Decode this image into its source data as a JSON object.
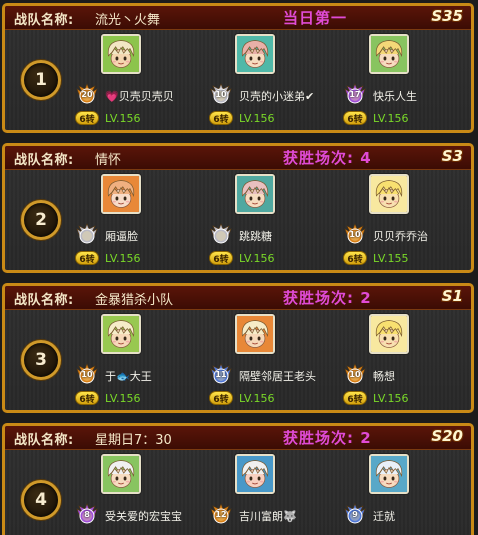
{
  "teams": [
    {
      "label": "战队名称:",
      "name": "流光丶火舞",
      "stat": "当日第一",
      "season": "S35",
      "rank": "1",
      "members": [
        {
          "name": "💗贝壳贝壳贝",
          "level": "6转",
          "lv": "LV.156",
          "badge": "20",
          "badge_color": "#d88018",
          "hair": "#f2e7c4",
          "skin": "#f5d6b0",
          "bg": "#8cc44c"
        },
        {
          "name": "贝壳的小迷弟✔",
          "level": "6转",
          "lv": "LV.156",
          "badge": "10",
          "badge_color": "#b9b9c4",
          "hair": "#e8b0a8",
          "skin": "#f6dcc0",
          "bg": "#50b8a8"
        },
        {
          "name": "快乐人生",
          "level": "6转",
          "lv": "LV.156",
          "badge": "17",
          "badge_color": "#a050d8",
          "hair": "#f4d878",
          "skin": "#f6dcc0",
          "bg": "#88c460"
        }
      ]
    },
    {
      "label": "战队名称:",
      "name": "情怀",
      "stat": "获胜场次: 4",
      "season": "S3",
      "rank": "2",
      "members": [
        {
          "name": "厢逼脸",
          "level": "6转",
          "lv": "LV.156",
          "badge": "",
          "badge_color": "#b9b9c4",
          "hair": "#f0b080",
          "skin": "#f8dcc8",
          "bg": "#e88838"
        },
        {
          "name": "跳跳糖",
          "level": "6转",
          "lv": "LV.156",
          "badge": "",
          "badge_color": "#b9b9c4",
          "hair": "#e8c0c0",
          "skin": "#f6dcc0",
          "bg": "#50a8a0"
        },
        {
          "name": "贝贝乔乔治",
          "level": "6转",
          "lv": "LV.155",
          "badge": "10",
          "badge_color": "#d88018",
          "hair": "#f8e070",
          "skin": "#f8e0b0",
          "bg": "#f8e8a0"
        }
      ]
    },
    {
      "label": "战队名称:",
      "name": "金暴猎杀小队",
      "stat": "获胜场次: 2",
      "season": "S1",
      "rank": "3",
      "members": [
        {
          "name": "于🐟大王",
          "level": "6转",
          "lv": "LV.156",
          "badge": "10",
          "badge_color": "#d88018",
          "hair": "#f6ecc8",
          "skin": "#f6d8b8",
          "bg": "#98c850"
        },
        {
          "name": "隔壁邻居王老头",
          "level": "6转",
          "lv": "LV.156",
          "badge": "11",
          "badge_color": "#5078d8",
          "hair": "#f6ecc8",
          "skin": "#f6d8b8",
          "bg": "#e88838"
        },
        {
          "name": "畅想",
          "level": "6转",
          "lv": "LV.156",
          "badge": "10",
          "badge_color": "#d88018",
          "hair": "#f8e070",
          "skin": "#f8e0b0",
          "bg": "#f8e8a0"
        }
      ]
    },
    {
      "label": "战队名称:",
      "name": "星期日7：30",
      "stat": "获胜场次: 2",
      "season": "S20",
      "rank": "4",
      "members": [
        {
          "name": "受关爱的宏宝宝",
          "level": "",
          "lv": "",
          "badge": "8",
          "badge_color": "#a050d8",
          "hair": "#f0f0f0",
          "skin": "#f6dcc0",
          "bg": "#88c460"
        },
        {
          "name": "吉川富朗🐺",
          "level": "",
          "lv": "",
          "badge": "12",
          "badge_color": "#d88018",
          "hair": "#f0f0f0",
          "skin": "#f8d0c0",
          "bg": "#4898c8"
        },
        {
          "name": "迁就",
          "level": "",
          "lv": "",
          "badge": "9",
          "badge_color": "#5078d8",
          "hair": "#e8f0f8",
          "skin": "#f6dcc0",
          "bg": "#58a8c8"
        }
      ]
    }
  ]
}
